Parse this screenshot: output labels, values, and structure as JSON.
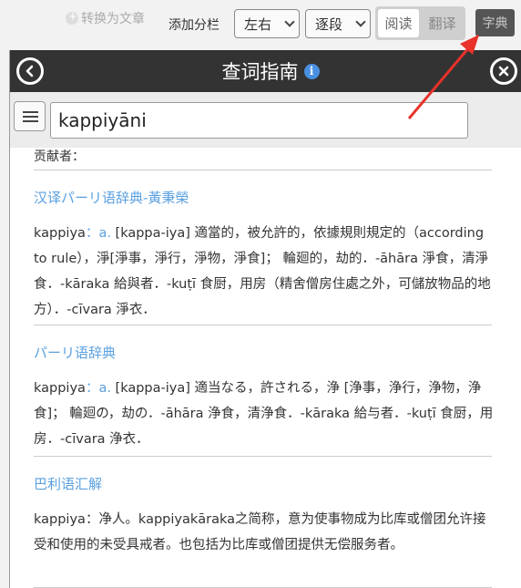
{
  "toolbar": {
    "convert_label": "转换为文章",
    "split_label": "添加分栏",
    "layout_select": "左右",
    "para_select": "逐段",
    "mode_read": "阅读",
    "mode_translate": "翻译",
    "dict_button": "字典"
  },
  "panel": {
    "title": "查词指南",
    "info_icon": "i",
    "search_value": "kappiyāni",
    "contributors_label": "贡献者："
  },
  "dictionaries": [
    {
      "name": "汉译パーリ语辞典-黃秉榮",
      "headword": "kappiya",
      "colon": "：",
      "pos": "a.",
      "body": "[kappa-iya] 適當的，被允許的，依據規則規定的（according to rule），淨[淨事，淨行，淨物，淨食]； 輪廻的，劫的．-āhāra 淨食，清淨食．-kāraka 給與者．-kuṭī 食厨，用房（精舍僧房住處之外，可儲放物品的地方）．-cīvara 淨衣．"
    },
    {
      "name": "パーリ语辞典",
      "headword": "kappiya",
      "colon": "：",
      "pos": "a.",
      "body": "[kappa-iya] 適当なる，許される，浄 [浄事，浄行，浄物，浄食]； 輪廻の，劫の．-āhāra 浄食，清浄食．-kāraka 給与者．-kuṭī 食厨，用房．-cīvara 浄衣．"
    },
    {
      "name": "巴利语汇解",
      "headword": "kappiya",
      "colon": "：",
      "pos": "",
      "body": "净人。kappiyakāraka之简称，意为使事物成为比库或僧团允许接受和使用的未受具戒者。也包括为比库或僧团提供无偿服务者。"
    }
  ],
  "colors": {
    "accent_link": "#5ba0e0",
    "header_bg": "#333333",
    "annotation_arrow": "#e8322a"
  },
  "icons": {
    "back": "back-circle-icon",
    "close": "close-circle-icon",
    "menu": "list-menu-icon",
    "info": "info-icon"
  }
}
